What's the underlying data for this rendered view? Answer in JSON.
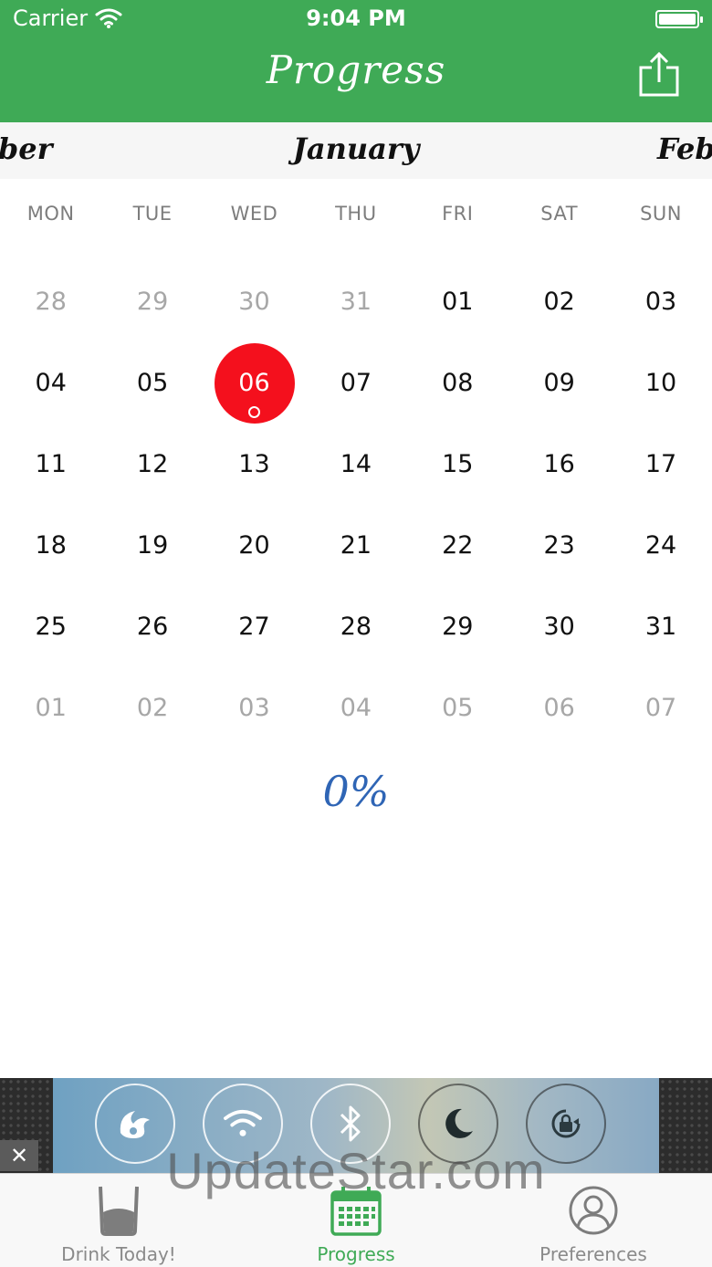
{
  "status_bar": {
    "carrier": "Carrier",
    "time": "9:04 PM"
  },
  "nav": {
    "title": "Progress",
    "share_icon": "share-icon"
  },
  "months": {
    "prev": "mber",
    "current": "January",
    "next": "Febr"
  },
  "weekdays": [
    "MON",
    "TUE",
    "WED",
    "THU",
    "FRI",
    "SAT",
    "SUN"
  ],
  "weeks": [
    [
      "28",
      "29",
      "30",
      "31",
      "01",
      "02",
      "03"
    ],
    [
      "04",
      "05",
      "06",
      "07",
      "08",
      "09",
      "10"
    ],
    [
      "11",
      "12",
      "13",
      "14",
      "15",
      "16",
      "17"
    ],
    [
      "18",
      "19",
      "20",
      "21",
      "22",
      "23",
      "24"
    ],
    [
      "25",
      "26",
      "27",
      "28",
      "29",
      "30",
      "31"
    ],
    [
      "01",
      "02",
      "03",
      "04",
      "05",
      "06",
      "07"
    ]
  ],
  "selected_day": "06",
  "progress": {
    "percent_label": "0%"
  },
  "ad": {
    "close_label": "✕",
    "icons": [
      "uc-browser-icon",
      "wifi-icon",
      "bluetooth-icon",
      "moon-icon",
      "rotation-lock-icon"
    ]
  },
  "watermark": "UpdateStar.com",
  "tabs": [
    {
      "label": "Drink Today!",
      "icon": "glass-icon",
      "active": false
    },
    {
      "label": "Progress",
      "icon": "calendar-icon",
      "active": true
    },
    {
      "label": "Preferences",
      "icon": "person-icon",
      "active": false
    }
  ],
  "colors": {
    "brand_green": "#3faa56",
    "today_red": "#f4101d",
    "percent_blue": "#2f65b5"
  }
}
